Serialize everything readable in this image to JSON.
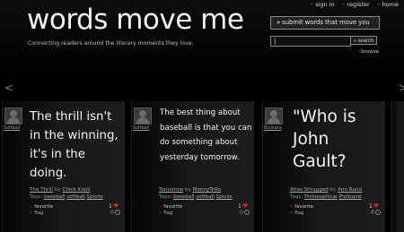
{
  "site": {
    "logo": "words move me",
    "tagline": "Connecting readers around the literary moments they love."
  },
  "top_nav": [
    "sign in",
    "register",
    "home"
  ],
  "submit_button": "submit words that move you",
  "search": {
    "value": "|",
    "button": "search"
  },
  "browse_link": "browse",
  "nav": {
    "prev_icon": "chevron-left-icon",
    "next_icon": "chevron-right-icon"
  },
  "cards": [
    {
      "user": "Softball",
      "quote": "The thrill isn't in the winning, it's in the doing.",
      "title": "The Thrill",
      "author": "Chick Knoll",
      "tags": [
        "baseball",
        "softball",
        "Sports"
      ],
      "favorite_label": "favorite",
      "flag_label": "flag",
      "favorite_count": "1",
      "flag_count": "0"
    },
    {
      "user": "Softball",
      "quote": "The best thing about baseball is that you can do something about yesterday tomorrow.",
      "title": "Tomorrow",
      "author": "MannyTrillo",
      "tags": [
        "baseball",
        "softball",
        "Sports"
      ],
      "favorite_label": "favorite",
      "flag_label": "flag",
      "favorite_count": "1",
      "flag_count": "0"
    },
    {
      "user": "Bookara",
      "quote": "\"Who is John Gault?",
      "title": "Atlas Shrugged",
      "author": "Ann Rand",
      "tags": [
        "Philosophical",
        "Profound"
      ],
      "favorite_label": "favorite",
      "flag_label": "flag",
      "favorite_count": "1",
      "flag_count": "0"
    }
  ],
  "labels": {
    "by": "by",
    "tags": "Tags:"
  },
  "colors": {
    "background": "#000000",
    "accent": "#cc2222",
    "heart": "#d42020",
    "text": "#f4f4f4"
  }
}
